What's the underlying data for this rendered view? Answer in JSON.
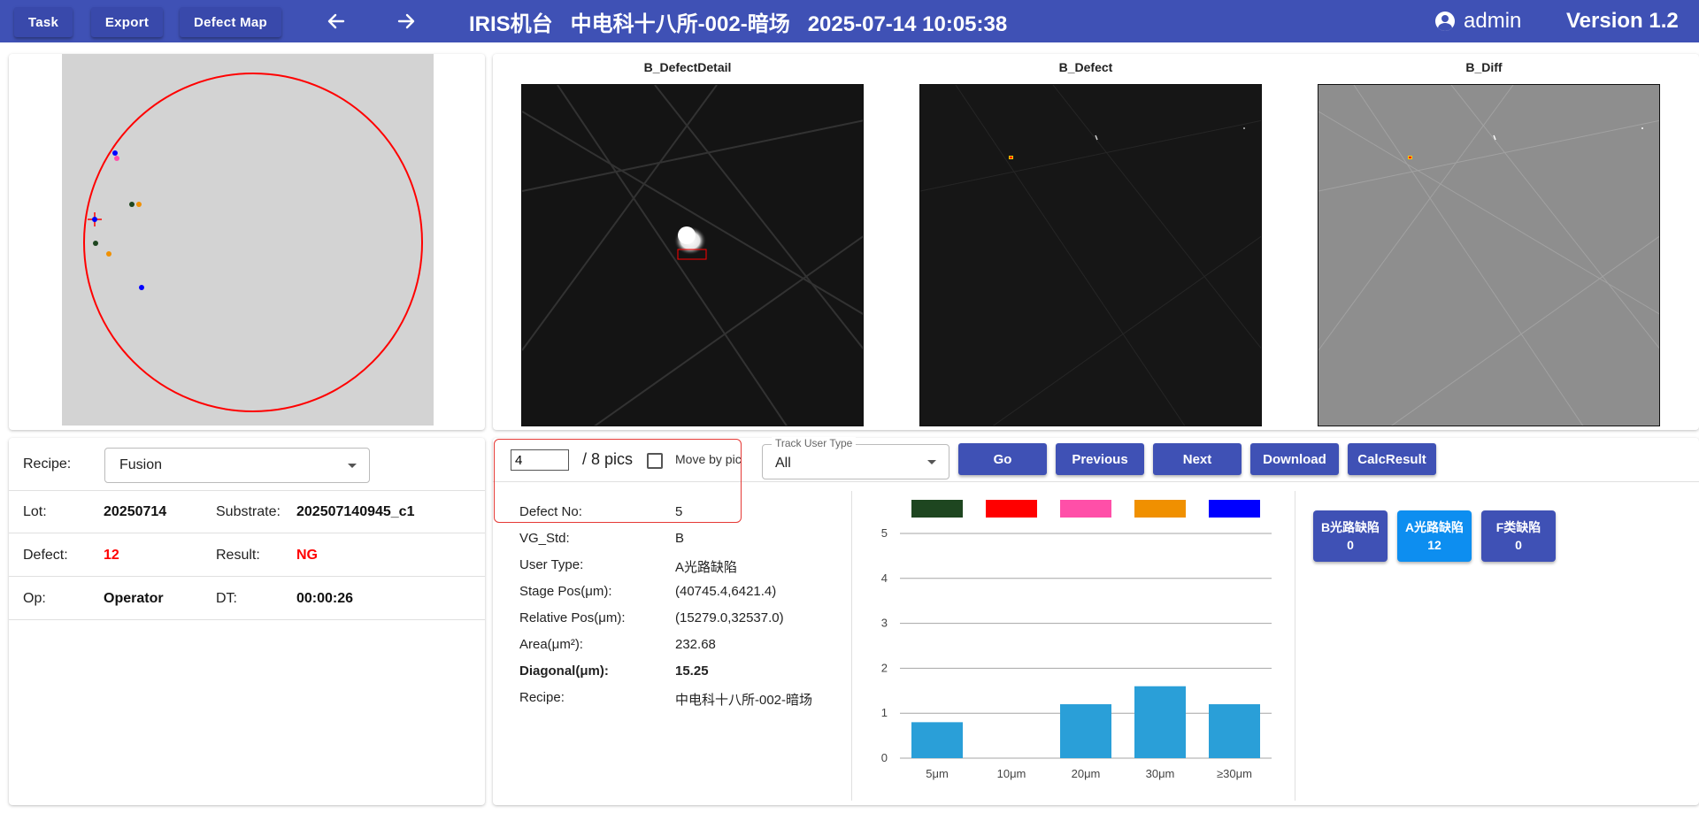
{
  "toolbar": {
    "task": "Task",
    "export": "Export",
    "defect_map": "Defect Map",
    "back_icon": "arrow-left-icon",
    "forward_icon": "arrow-right-icon",
    "title": "IRIS机台   中电科十八所-002-暗场   2025-07-14 10:05:38",
    "user": "admin",
    "version": "Version 1.2"
  },
  "images": {
    "detail_title": "B_DefectDetail",
    "defect_title": "B_Defect",
    "diff_title": "B_Diff"
  },
  "info": {
    "recipe_label": "Recipe:",
    "recipe_value": "Fusion",
    "lot_label": "Lot:",
    "lot_value": "20250714",
    "substrate_label": "Substrate:",
    "substrate_value": "202507140945_c1",
    "defect_label": "Defect:",
    "defect_value": "12",
    "result_label": "Result:",
    "result_value": "NG",
    "op_label": "Op:",
    "op_value": "Operator",
    "dt_label": "DT:",
    "dt_value": "00:00:26"
  },
  "nav": {
    "pic_input": "4",
    "pic_total": "/ 8 pics",
    "move_by_pic": "Move by pic",
    "move_by_pic_checked": false,
    "track_label": "Track User Type",
    "track_value": "All",
    "go": "Go",
    "previous": "Previous",
    "next": "Next",
    "download": "Download",
    "calc_result": "CalcResult"
  },
  "details": [
    {
      "label": "Defect No:",
      "value": "5",
      "bold": false
    },
    {
      "label": "VG_Std:",
      "value": "B",
      "bold": false
    },
    {
      "label": "User Type:",
      "value": "A光路缺陷",
      "bold": false
    },
    {
      "label": "Stage Pos(μm):",
      "value": "(40745.4,6421.4)",
      "bold": false
    },
    {
      "label": "Relative Pos(μm):",
      "value": "(15279.0,32537.0)",
      "bold": false
    },
    {
      "label": "Area(μm²):",
      "value": "232.68",
      "bold": false
    },
    {
      "label": "Diagonal(μm):",
      "value": "15.25",
      "bold": true
    },
    {
      "label": "Recipe:",
      "value": "中电科十八所-002-暗场",
      "bold": false
    }
  ],
  "legend_colors": [
    "#1e4620",
    "#ff0000",
    "#ff4fa8",
    "#f09000",
    "#0000ff"
  ],
  "chart_data": {
    "type": "bar",
    "categories": [
      "5μm",
      "10μm",
      "20μm",
      "30μm",
      "≥30μm"
    ],
    "values": [
      0.8,
      0,
      1.2,
      1.6,
      1.2
    ],
    "ylim": [
      0,
      5
    ],
    "yticks": [
      "0",
      "1",
      "2",
      "3",
      "4",
      "5"
    ],
    "bar_color": "#2a9fd8",
    "grid": true
  },
  "badges": [
    {
      "label": "B光路缺陷",
      "count": "0",
      "color": "#3f51b5"
    },
    {
      "label": "A光路缺陷",
      "count": "12",
      "color": "#0d8ef0"
    },
    {
      "label": "F类缺陷",
      "count": "0",
      "color": "#3f51b5"
    }
  ]
}
